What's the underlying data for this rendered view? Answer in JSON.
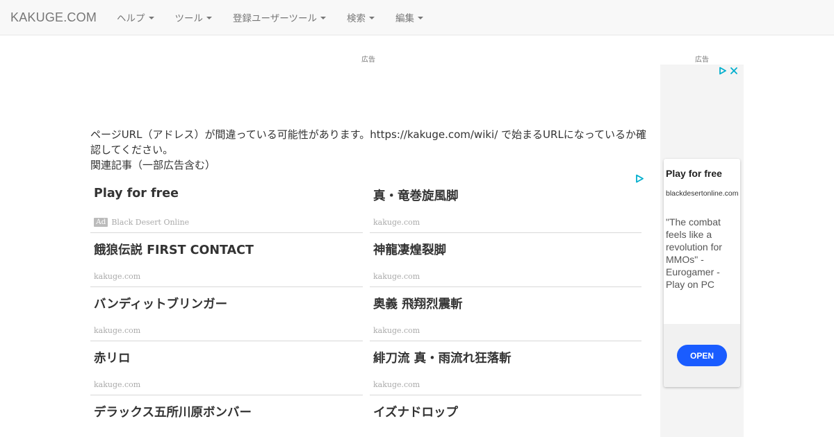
{
  "navbar": {
    "brand": "KAKUGE.COM",
    "menus": [
      "ヘルプ",
      "ツール",
      "登録ユーザーツール",
      "検索",
      "編集"
    ]
  },
  "ads": {
    "label": "広告"
  },
  "main": {
    "notice": "ページURL（アドレス）が間違っている可能性があります。https://kakuge.com/wiki/ で始まるURLになっているか確認してください。",
    "related_heading": "関連記事（一部広告含む）",
    "left_column": [
      {
        "title": "Play for free",
        "badge": "Ad",
        "source": "Black Desert Online"
      },
      {
        "title": "餓狼伝説 FIRST CONTACT",
        "source": "kakuge.com"
      },
      {
        "title": "バンディットブリンガー",
        "source": "kakuge.com"
      },
      {
        "title": "赤リロ",
        "source": "kakuge.com"
      },
      {
        "title": "デラックス五所川原ボンバー",
        "source": ""
      }
    ],
    "right_column": [
      {
        "title": "真・竜巻旋風脚",
        "source": "kakuge.com"
      },
      {
        "title": "神龍凄煌裂脚",
        "source": "kakuge.com"
      },
      {
        "title": "奥義 飛翔烈震斬",
        "source": "kakuge.com"
      },
      {
        "title": "緋刀流 真・雨流れ狂落斬",
        "source": "kakuge.com"
      },
      {
        "title": "イズナドロップ",
        "source": ""
      }
    ]
  },
  "sidebar_ad": {
    "headline": "Play for free",
    "domain": "blackdesertonline.com",
    "body": "\"The combat feels like a revolution for MMOs\" - Eurogamer - Play on PC",
    "cta": "OPEN"
  },
  "colors": {
    "navbar_bg": "#f8f8f8",
    "adchoices": "#00aecd",
    "cta_blue": "#1a5cff"
  },
  "icons": [
    "adchoices-icon",
    "close-x-icon",
    "caret-down-icon"
  ]
}
